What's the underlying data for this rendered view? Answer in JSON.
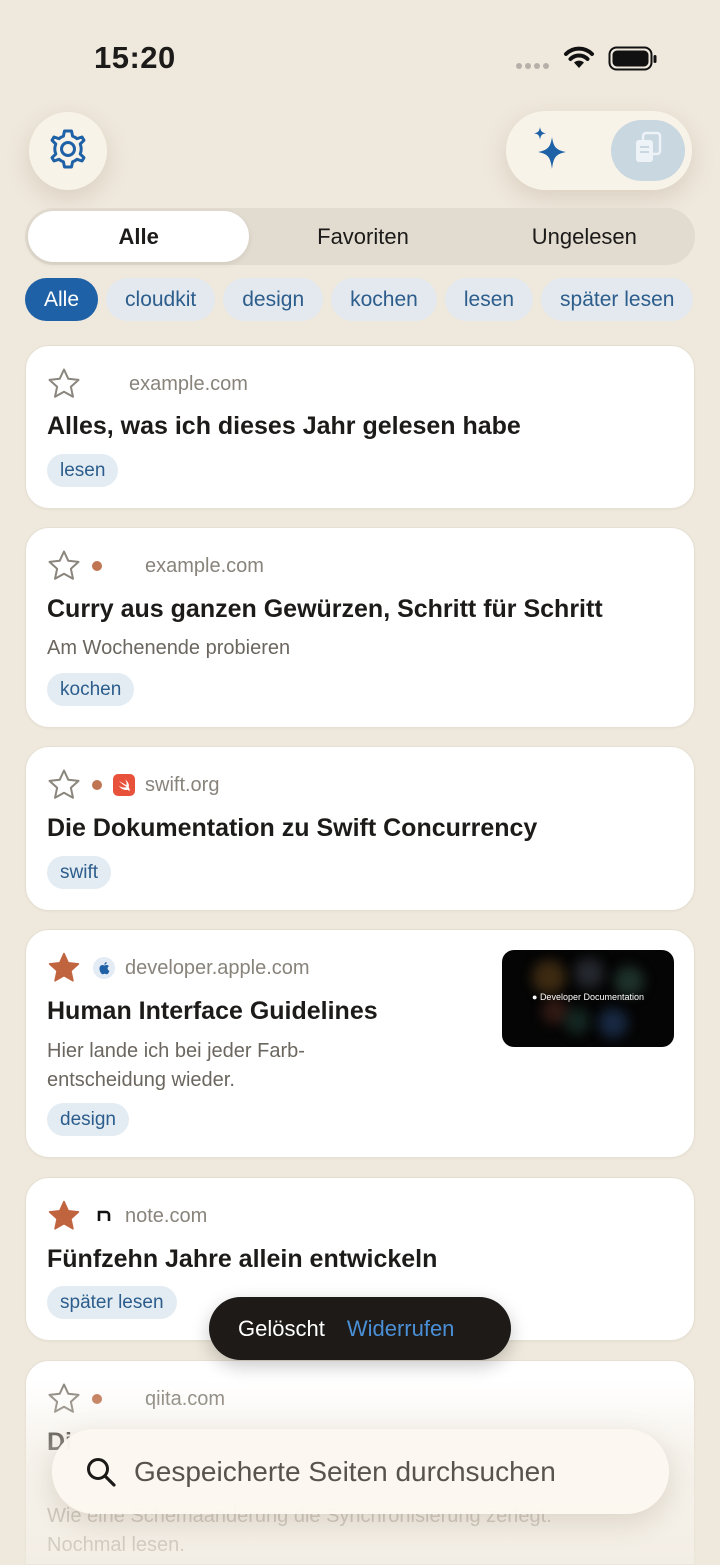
{
  "status_bar": {
    "time": "15:20"
  },
  "toolbar": {
    "settings_icon": "gear-icon",
    "sparkle_icon": "sparkles-icon",
    "paste_icon": "clipboard-icon",
    "accent": "#1f61a6"
  },
  "segments": [
    {
      "label": "Alle",
      "selected": true
    },
    {
      "label": "Favoriten",
      "selected": false
    },
    {
      "label": "Ungelesen",
      "selected": false
    }
  ],
  "tag_filters": [
    {
      "label": "Alle",
      "selected": true
    },
    {
      "label": "cloudkit"
    },
    {
      "label": "design"
    },
    {
      "label": "kochen"
    },
    {
      "label": "lesen"
    },
    {
      "label": "später lesen"
    }
  ],
  "items": [
    {
      "favorite": false,
      "unread": false,
      "domain": "example.com",
      "title": "Alles, was ich dieses Jahr gelesen habe",
      "tag": "lesen"
    },
    {
      "favorite": false,
      "unread": true,
      "domain": "example.com",
      "title": "Curry aus ganzen Gewürzen, Schritt für Schritt",
      "note": "Am Wochenende probieren",
      "tag": "kochen"
    },
    {
      "favorite": false,
      "unread": true,
      "domain": "swift.org",
      "title": "Die Dokumentation zu Swift Concurrency",
      "tag": "swift",
      "favicon": "swift-icon"
    },
    {
      "favorite": true,
      "unread": false,
      "domain": "developer.apple.com",
      "title": "Human Interface Guidelines",
      "note_lines": [
        "Hier lande ich bei jeder Farb-",
        "entscheidung wieder."
      ],
      "tag": "design",
      "favicon": "apple-icon",
      "thumbnail_text": "Developer Documentation"
    },
    {
      "favorite": true,
      "unread": false,
      "domain": "note.com",
      "title": "Fünfzehn Jahre allein entwickeln",
      "tag": "später lesen",
      "favicon": "note-icon"
    },
    {
      "favorite": false,
      "unread": true,
      "domain": "qiita.com",
      "title_partial": "Di",
      "note_lines": [
        "Wie eine Schemaänderung die Synchronisierung zerlegt.",
        "Nochmal lesen."
      ]
    }
  ],
  "toast": {
    "message": "Gelöscht",
    "action": "Widerrufen"
  },
  "search": {
    "placeholder": "Gespeicherte Seiten durchsuchen"
  },
  "colors": {
    "background": "#efe8dc",
    "star_filled": "#c0643f",
    "unread_dot": "#c07552",
    "tag_text": "#2c5d8c"
  }
}
